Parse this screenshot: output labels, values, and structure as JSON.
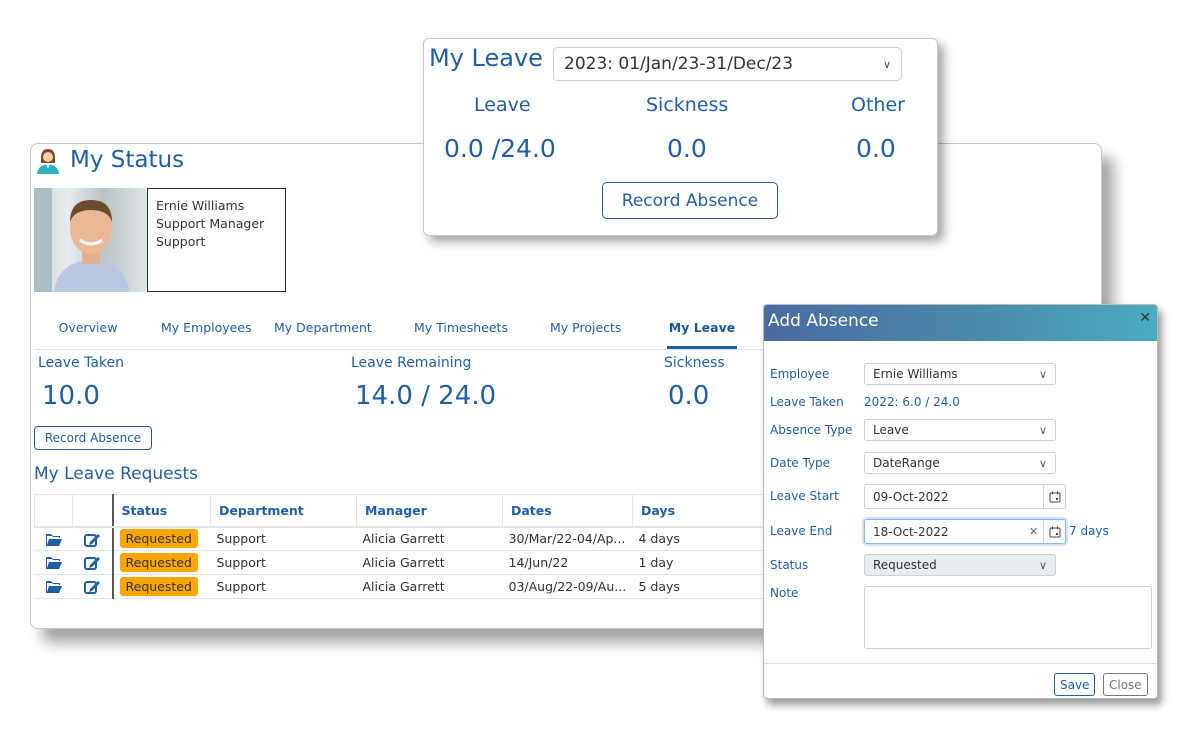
{
  "my_leave_popup": {
    "title": "My Leave",
    "period": "2023: 01/Jan/23-31/Dec/23",
    "leave_label": "Leave",
    "leave_value": "0.0 /24.0",
    "sickness_label": "Sickness",
    "sickness_value": "0.0",
    "other_label": "Other",
    "other_value": "0.0",
    "record_absence": "Record Absence"
  },
  "status": {
    "title": "My Status",
    "employee": {
      "name": "Ernie Williams",
      "role": "Support Manager",
      "department": "Support"
    },
    "tabs": [
      "Overview",
      "My Employees",
      "My Department",
      "My Timesheets",
      "My Projects",
      "My Leave"
    ],
    "active_tab": "My Leave",
    "leave_taken_label": "Leave Taken",
    "leave_taken_value": "10.0",
    "leave_remaining_label": "Leave Remaining",
    "leave_remaining_value": "14.0 / 24.0",
    "sickness_label": "Sickness",
    "sickness_value": "0.0",
    "record_absence": "Record Absence",
    "requests_title": "My Leave Requests",
    "table": {
      "headers": [
        "Status",
        "Department",
        "Manager",
        "Dates",
        "Days"
      ],
      "rows": [
        {
          "status": "Requested",
          "department": "Support",
          "manager": "Alicia Garrett",
          "dates": "30/Mar/22-04/Ap...",
          "days": "4 days"
        },
        {
          "status": "Requested",
          "department": "Support",
          "manager": "Alicia Garrett",
          "dates": "14/Jun/22",
          "days": "1 day"
        },
        {
          "status": "Requested",
          "department": "Support",
          "manager": "Alicia Garrett",
          "dates": "03/Aug/22-09/Au...",
          "days": "5 days"
        }
      ]
    }
  },
  "dialog": {
    "title": "Add Absence",
    "employee_label": "Employee",
    "employee_value": "Ernie Williams",
    "leave_taken_label": "Leave Taken",
    "leave_taken_value": "2022: 6.0 / 24.0",
    "absence_type_label": "Absence Type",
    "absence_type_value": "Leave",
    "date_type_label": "Date Type",
    "date_type_value": "DateRange",
    "leave_start_label": "Leave Start",
    "leave_start_value": "09-Oct-2022",
    "leave_end_label": "Leave End",
    "leave_end_value": "18-Oct-2022",
    "days_count": "7 days",
    "status_label": "Status",
    "status_value": "Requested",
    "note_label": "Note",
    "note_value": "",
    "save": "Save",
    "close": "Close"
  },
  "colors": {
    "accent": "#1f5fa8",
    "badge": "#ffa500"
  }
}
